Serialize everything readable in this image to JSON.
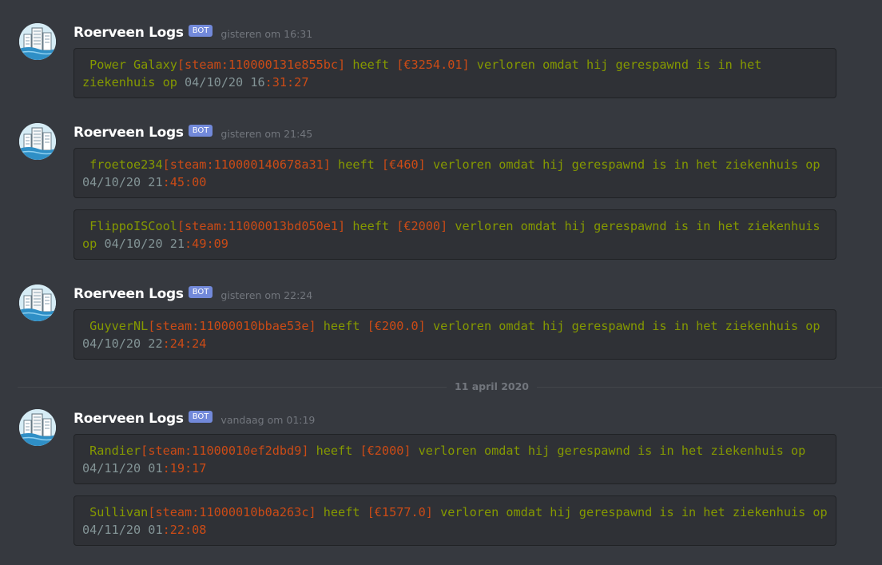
{
  "divider": {
    "label": "11 april 2020"
  },
  "messages": [
    {
      "author": "Roerveen Logs",
      "badge": "BOT",
      "timestamp": "gisteren om 16:31",
      "logs": [
        {
          "name": " Power Galaxy",
          "steam": "[steam:110000131e855bc]",
          "w1": " heeft ",
          "amount": "[€3254.01]",
          "w2": " verloren omdat hij gerespawnd is in het ziekenhuis op ",
          "date": "04/10/20 ",
          "hour": "16",
          "minsec": ":31:27"
        }
      ]
    },
    {
      "author": "Roerveen Logs",
      "badge": "BOT",
      "timestamp": "gisteren om 21:45",
      "logs": [
        {
          "name": " froetoe234",
          "steam": "[steam:110000140678a31]",
          "w1": " heeft ",
          "amount": "[€460]",
          "w2": " verloren omdat hij gerespawnd is in het ziekenhuis op ",
          "date": "04/10/20 ",
          "hour": "21",
          "minsec": ":45:00"
        },
        {
          "name": " FlippoISCool",
          "steam": "[steam:11000013bd050e1]",
          "w1": " heeft ",
          "amount": "[€2000]",
          "w2": " verloren omdat hij gerespawnd is in het ziekenhuis op ",
          "date": "04/10/20 ",
          "hour": "21",
          "minsec": ":49:09"
        }
      ]
    },
    {
      "author": "Roerveen Logs",
      "badge": "BOT",
      "timestamp": "gisteren om 22:24",
      "logs": [
        {
          "name": " GuyverNL",
          "steam": "[steam:11000010bbae53e]",
          "w1": " heeft ",
          "amount": "[€200.0]",
          "w2": " verloren omdat hij gerespawnd is in het ziekenhuis op ",
          "date": "04/10/20 ",
          "hour": "22",
          "minsec": ":24:24"
        }
      ]
    },
    {
      "author": "Roerveen Logs",
      "badge": "BOT",
      "timestamp": "vandaag om 01:19",
      "logs": [
        {
          "name": " Randier",
          "steam": "[steam:11000010ef2dbd9]",
          "w1": " heeft ",
          "amount": "[€2000]",
          "w2": " verloren omdat hij gerespawnd is in het ziekenhuis op ",
          "date": "04/11/20 ",
          "hour": "01",
          "minsec": ":19:17"
        },
        {
          "name": " Sullivan",
          "steam": "[steam:11000010b0a263c]",
          "w1": " heeft ",
          "amount": "[€1577.0]",
          "w2": " verloren omdat hij gerespawnd is in het ziekenhuis op ",
          "date": "04/11/20 ",
          "hour": "01",
          "minsec": ":22:08"
        }
      ]
    }
  ]
}
